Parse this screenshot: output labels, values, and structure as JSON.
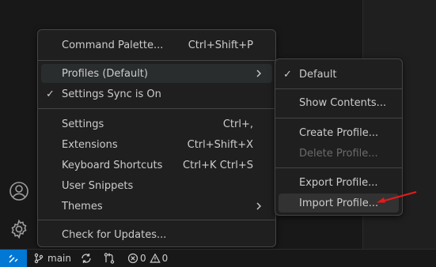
{
  "main_menu": {
    "items": [
      {
        "label": "Command Palette...",
        "shortcut": "Ctrl+Shift+P"
      },
      {
        "label": "Profiles (Default)",
        "shortcut": ""
      },
      {
        "label": "Settings Sync is On",
        "shortcut": ""
      },
      {
        "label": "Settings",
        "shortcut": "Ctrl+,"
      },
      {
        "label": "Extensions",
        "shortcut": "Ctrl+Shift+X"
      },
      {
        "label": "Keyboard Shortcuts",
        "shortcut": "Ctrl+K Ctrl+S"
      },
      {
        "label": "User Snippets",
        "shortcut": ""
      },
      {
        "label": "Themes",
        "shortcut": ""
      },
      {
        "label": "Check for Updates...",
        "shortcut": ""
      }
    ]
  },
  "profiles_menu": {
    "items": [
      {
        "label": "Default"
      },
      {
        "label": "Show Contents..."
      },
      {
        "label": "Create Profile..."
      },
      {
        "label": "Delete Profile..."
      },
      {
        "label": "Export Profile..."
      },
      {
        "label": "Import Profile..."
      }
    ]
  },
  "statusbar": {
    "branch": "main",
    "errors": "0",
    "warnings": "0"
  },
  "colors": {
    "accent": "#0078d4",
    "annotation_arrow": "#e51a1a"
  }
}
